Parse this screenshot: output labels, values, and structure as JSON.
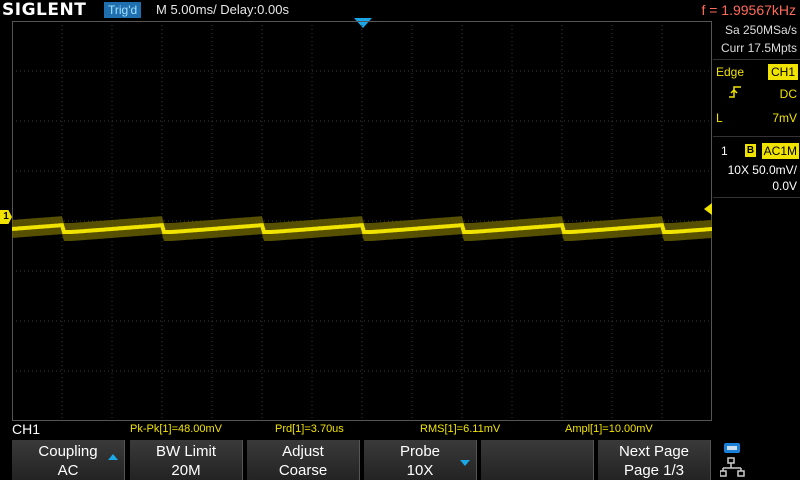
{
  "header": {
    "brand": "SIGLENT",
    "trigger_status": "Trig'd",
    "timebase": "M 5.00ms/ Delay:0.00s",
    "frequency": "f = 1.99567kHz"
  },
  "acquisition": {
    "sample_rate": "Sa 250MSa/s",
    "memory": "Curr 17.5Mpts"
  },
  "trigger": {
    "type": "Edge",
    "source": "CH1",
    "slope_icon": "rising-edge-icon",
    "coupling": "DC",
    "level_label": "L",
    "level_value": "7mV"
  },
  "channel": {
    "number": "1",
    "bw_icon": "B",
    "coupling_badge": "AC1M",
    "probe_scale": "10X  50.0mV/",
    "offset": "0.0V",
    "marker": "1",
    "color": "#f1e300"
  },
  "measurements": {
    "channel_label": "CH1",
    "items": [
      "Pk-Pk[1]=48.00mV",
      "Prd[1]=3.70us",
      "RMS[1]=6.11mV",
      "Ampl[1]=10.00mV"
    ]
  },
  "softkeys": [
    {
      "line1": "Coupling",
      "line2": "AC",
      "arrow": "up"
    },
    {
      "line1": "BW Limit",
      "line2": "20M",
      "arrow": ""
    },
    {
      "line1": "Adjust",
      "line2": "Coarse",
      "arrow": ""
    },
    {
      "line1": "Probe",
      "line2": "10X",
      "arrow": "down"
    },
    {
      "line1": "",
      "line2": "",
      "arrow": ""
    },
    {
      "line1": "Next Page",
      "line2": "Page 1/3",
      "arrow": ""
    }
  ],
  "colors": {
    "accent": "#1aa7e8",
    "trace": "#f1e300",
    "frequency": "#ff6b57"
  }
}
